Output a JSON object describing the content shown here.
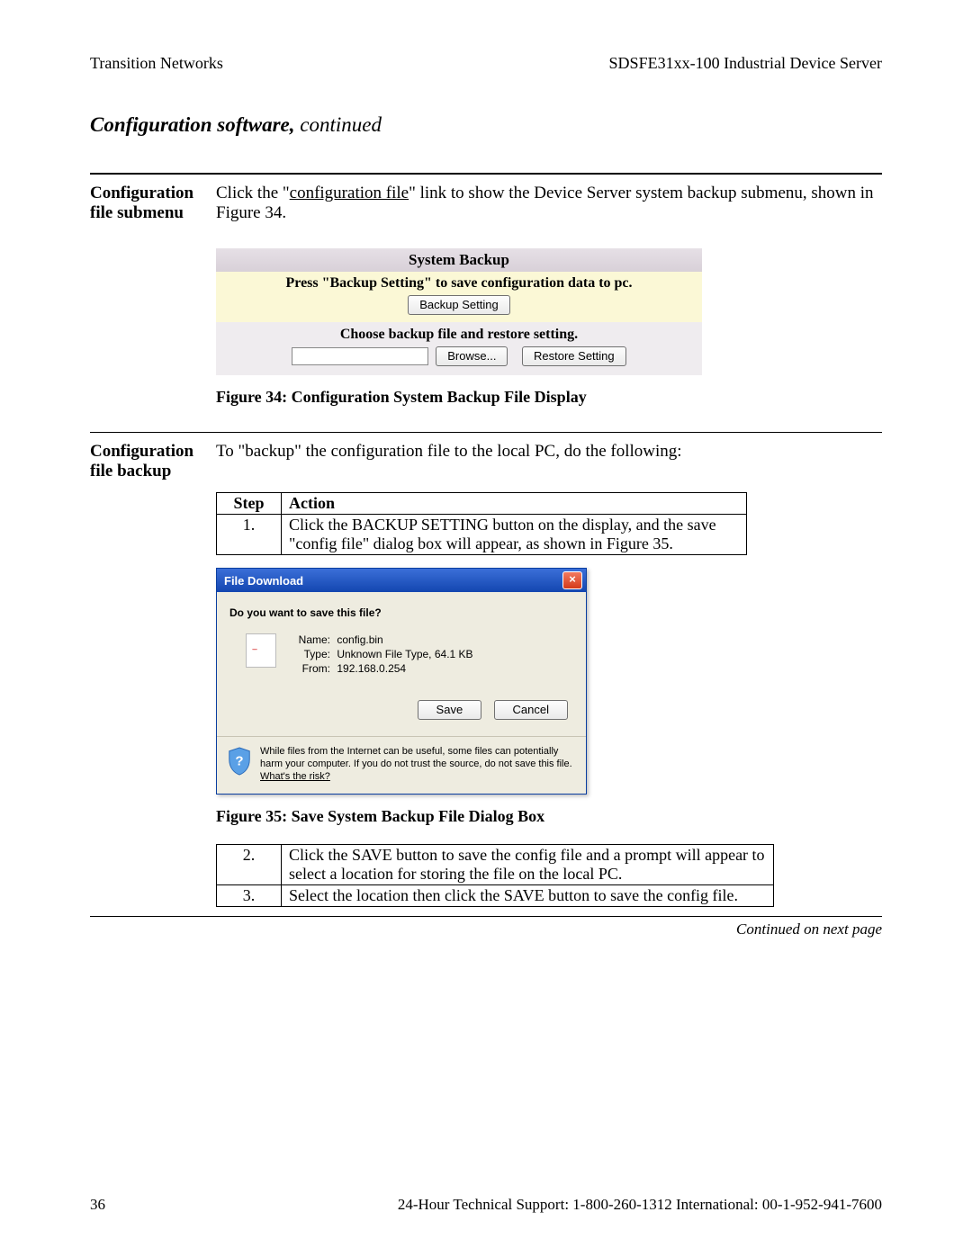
{
  "header": {
    "left": "Transition Networks",
    "right": "SDSFE31xx-100 Industrial Device Server"
  },
  "section_title": {
    "main": "Configuration software,",
    "cont": " continued"
  },
  "config_submenu": {
    "label": "Configuration file submenu",
    "text_before": "Click the \"",
    "link": "configuration file",
    "text_after": "\" link to show the Device Server system backup submenu, shown in Figure 34."
  },
  "sysbackup": {
    "title": "System Backup",
    "yellow_msg": "Press \"Backup Setting\" to save configuration data to pc.",
    "backup_btn": "Backup Setting",
    "grey_msg": "Choose backup file and restore setting.",
    "browse_btn": "Browse...",
    "restore_btn": "Restore Setting"
  },
  "fig34": "Figure 34:  Configuration System Backup File Display",
  "config_backup": {
    "label": "Configuration file backup",
    "intro": "To \"backup\" the configuration file to the local PC, do the following:"
  },
  "table1": {
    "head_step": "Step",
    "head_action": "Action",
    "rows": [
      {
        "step": "1.",
        "action": "Click the BACKUP SETTING button on the display, and the save \"config file\" dialog box will appear, as shown in Figure 35."
      }
    ]
  },
  "dialog": {
    "title": "File Download",
    "question": "Do you want to save this file?",
    "name_k": "Name:",
    "name_v": "config.bin",
    "type_k": "Type:",
    "type_v": "Unknown File Type, 64.1 KB",
    "from_k": "From:",
    "from_v": "192.168.0.254",
    "save_btn": "Save",
    "cancel_btn": "Cancel",
    "warn": "While files from the Internet can be useful, some files can potentially harm your computer. If you do not trust the source, do not save this file. ",
    "risk": "What's the risk?"
  },
  "fig35": "Figure 35:  Save System Backup File Dialog Box",
  "table2": {
    "rows": [
      {
        "step": "2.",
        "action": "Click the SAVE button to save the config file and a prompt will appear to select a location for storing the file on the local PC."
      },
      {
        "step": "3.",
        "action": "Select the location then click the SAVE button to save the config file."
      }
    ]
  },
  "continued": "Continued on next page",
  "footer": {
    "page": "36",
    "support": "24-Hour Technical Support:  1-800-260-1312   International: 00-1-952-941-7600"
  }
}
